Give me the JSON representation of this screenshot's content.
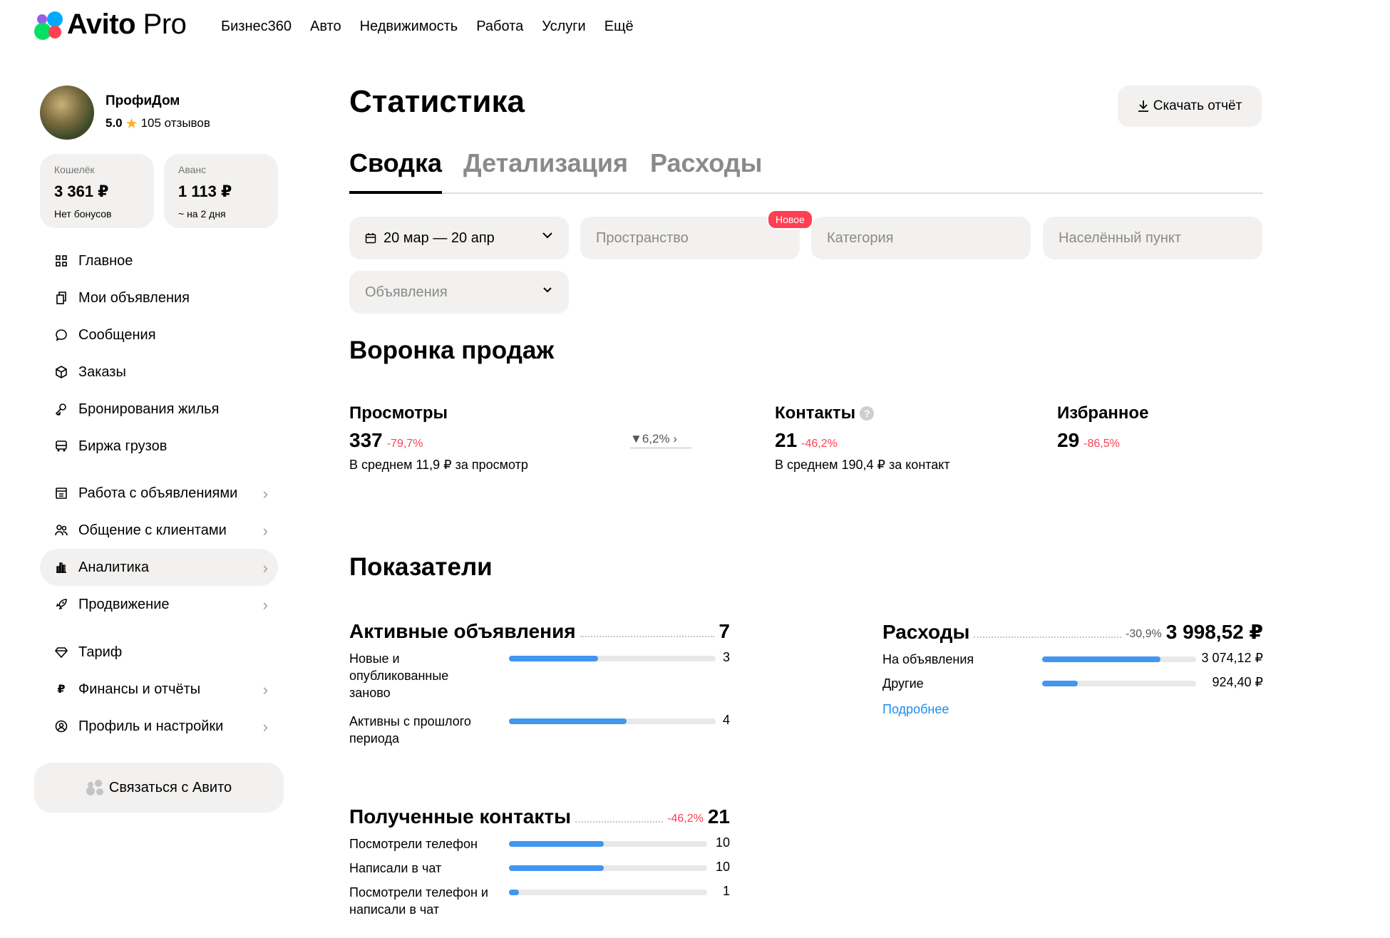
{
  "header": {
    "logo_bold": "Avito",
    "logo_light": "Pro",
    "nav": [
      "Бизнес360",
      "Авто",
      "Недвижимость",
      "Работа",
      "Услуги",
      "Ещё"
    ]
  },
  "profile": {
    "name": "ПрофиДом",
    "rating": "5.0",
    "reviews": "105 отзывов"
  },
  "wallet": {
    "wallet_title": "Кошелёк",
    "wallet_value": "3 361 ₽",
    "wallet_sub": "Нет бонусов",
    "advance_title": "Аванс",
    "advance_value": "1 113 ₽",
    "advance_sub": "~ на 2 дня"
  },
  "menu": {
    "main": "Главное",
    "my_ads": "Мои объявления",
    "messages": "Сообщения",
    "orders": "Заказы",
    "bookings": "Бронирования жилья",
    "cargo": "Биржа грузов",
    "ads_work": "Работа с объявлениями",
    "clients": "Общение с клиентами",
    "analytics": "Аналитика",
    "promotion": "Продвижение",
    "tariff": "Тариф",
    "finance": "Финансы и отчёты",
    "profile_settings": "Профиль и настройки"
  },
  "contact_button": "Связаться с Авито",
  "page": {
    "title": "Статистика",
    "download": "Скачать отчёт",
    "tabs": [
      "Сводка",
      "Детализация",
      "Расходы"
    ]
  },
  "filters": {
    "date": "20 мар — 20 апр",
    "space": "Пространство",
    "new_badge": "Новое",
    "category": "Категория",
    "locality": "Населённый пункт",
    "ads": "Объявления"
  },
  "funnel": {
    "title": "Воронка продаж",
    "views_label": "Просмотры",
    "views_value": "337",
    "views_delta": "-79,7%",
    "views_sub": "В среднем 11,9 ₽ за просмотр",
    "conversion": "6,2%",
    "contacts_label": "Контакты",
    "contacts_value": "21",
    "contacts_delta": "-46,2%",
    "contacts_sub": "В среднем 190,4 ₽ за контакт",
    "favorites_label": "Избранное",
    "favorites_value": "29",
    "favorites_delta": "-86,5%"
  },
  "indicators": {
    "title": "Показатели",
    "active": {
      "label": "Активные объявления",
      "value": "7",
      "rows": [
        {
          "label": "Новые и опубликованные заново",
          "value": "3",
          "fraction": 0.43
        },
        {
          "label": "Активны с прошлого периода",
          "value": "4",
          "fraction": 0.57
        }
      ]
    },
    "expenses": {
      "label": "Расходы",
      "delta": "-30,9%",
      "value": "3 998,52 ₽",
      "rows": [
        {
          "label": "На объявления",
          "value": "3 074,12 ₽",
          "fraction": 0.77
        },
        {
          "label": "Другие",
          "value": "924,40 ₽",
          "fraction": 0.23
        }
      ],
      "more": "Подробнее"
    },
    "contacts": {
      "label": "Полученные контакты",
      "delta": "-46,2%",
      "value": "21",
      "rows": [
        {
          "label": "Посмотрели телефон",
          "value": "10",
          "fraction": 0.48
        },
        {
          "label": "Написали в чат",
          "value": "10",
          "fraction": 0.48
        },
        {
          "label": "Посмотрели телефон и написали в чат",
          "value": "1",
          "fraction": 0.05
        }
      ]
    }
  },
  "colors": {
    "accent_blue": "#4196f0",
    "negative_red": "#ff4053",
    "link_blue": "#1f8cf0",
    "surface_gray": "#f2f1f0"
  }
}
